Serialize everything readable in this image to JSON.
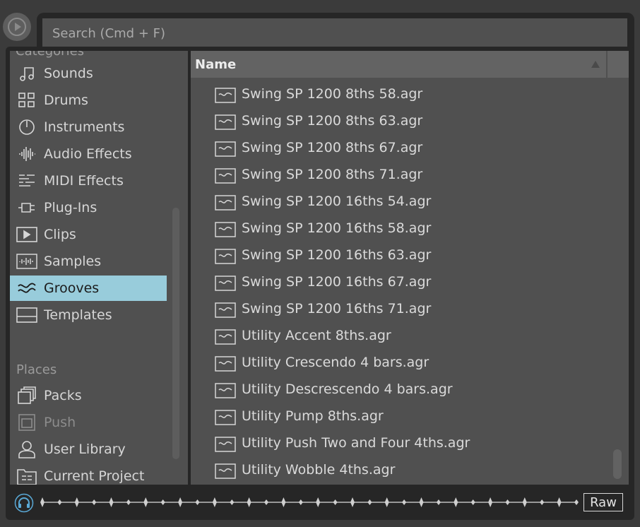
{
  "search": {
    "placeholder": "Search (Cmd + F)"
  },
  "sidebar": {
    "categories_heading": "Categories",
    "categories": [
      {
        "label": "Sounds",
        "icon": "note-icon"
      },
      {
        "label": "Drums",
        "icon": "drum-grid-icon"
      },
      {
        "label": "Instruments",
        "icon": "knob-icon"
      },
      {
        "label": "Audio Effects",
        "icon": "audio-effects-icon"
      },
      {
        "label": "MIDI Effects",
        "icon": "midi-effects-icon"
      },
      {
        "label": "Plug-Ins",
        "icon": "plug-icon"
      },
      {
        "label": "Clips",
        "icon": "clip-icon"
      },
      {
        "label": "Samples",
        "icon": "sample-icon"
      },
      {
        "label": "Grooves",
        "icon": "groove-icon",
        "selected": true
      },
      {
        "label": "Templates",
        "icon": "template-icon"
      }
    ],
    "places_heading": "Places",
    "places": [
      {
        "label": "Packs",
        "icon": "packs-icon"
      },
      {
        "label": "Push",
        "icon": "push-icon",
        "disabled": true
      },
      {
        "label": "User Library",
        "icon": "user-icon"
      },
      {
        "label": "Current Project",
        "icon": "project-folder-icon"
      }
    ]
  },
  "file_list": {
    "column_name": "Name",
    "sort": "ascending",
    "items": [
      "Swing SP 1200 8ths 58.agr",
      "Swing SP 1200 8ths 63.agr",
      "Swing SP 1200 8ths 67.agr",
      "Swing SP 1200 8ths 71.agr",
      "Swing SP 1200 16ths 54.agr",
      "Swing SP 1200 16ths 58.agr",
      "Swing SP 1200 16ths 63.agr",
      "Swing SP 1200 16ths 67.agr",
      "Swing SP 1200 16ths 71.agr",
      "Utility Accent 8ths.agr",
      "Utility Crescendo 4 bars.agr",
      "Utility Descrescendo 4 bars.agr",
      "Utility Pump 8ths.agr",
      "Utility Push Two and Four 4ths.agr",
      "Utility Wobble 4ths.agr"
    ]
  },
  "preview": {
    "raw_label": "Raw",
    "icon": "headphones-icon"
  },
  "colors": {
    "selected_bg": "#98ccdb",
    "panel_bg": "#505050",
    "frame_bg": "#262626"
  }
}
